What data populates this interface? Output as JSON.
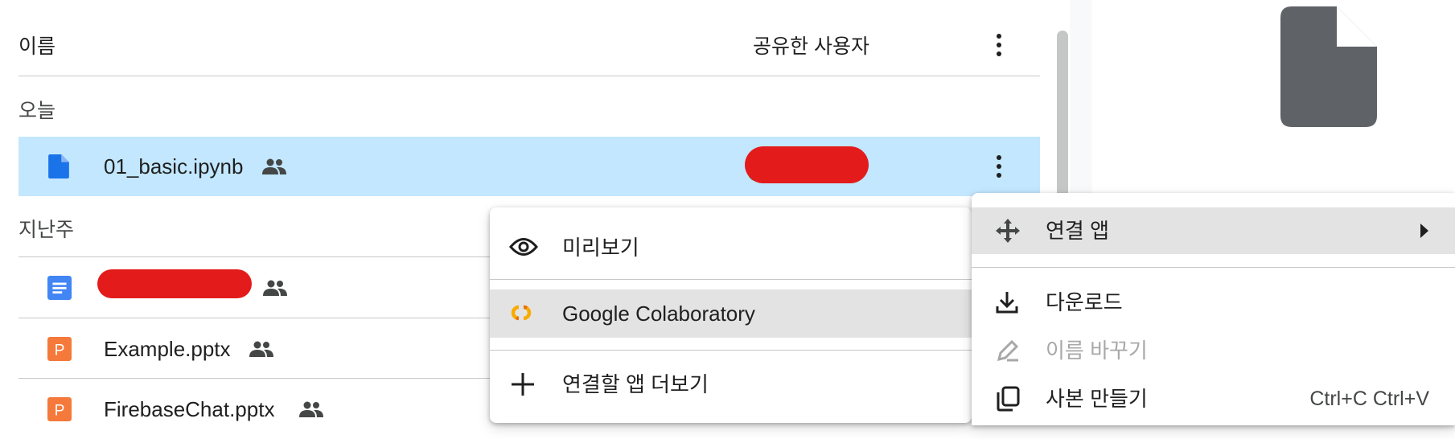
{
  "list_header": {
    "name_col": "이름",
    "shared_col": "공유한 사용자"
  },
  "sections": {
    "today": "오늘",
    "last_week": "지난주"
  },
  "files": [
    {
      "name": "01_basic.ipynb",
      "type": "file-icon",
      "selected": true
    },
    {
      "name": "",
      "type": "docs-icon",
      "redacted": true
    },
    {
      "name": "Example.pptx",
      "type": "slides-icon"
    },
    {
      "name": "FirebaseChat.pptx",
      "type": "slides-icon"
    }
  ],
  "open_with_submenu": {
    "items": [
      {
        "label": "미리보기",
        "icon": "eye-icon"
      },
      {
        "label": "Google Colaboratory",
        "icon": "colab-icon",
        "highlighted": true
      },
      {
        "label": "연결할 앱 더보기",
        "icon": "plus-icon"
      }
    ]
  },
  "context_menu": {
    "items": [
      {
        "label": "연결 앱",
        "icon": "move-icon",
        "highlighted": true,
        "has_submenu": true
      },
      {
        "label": "다운로드",
        "icon": "download-icon"
      },
      {
        "label": "이름 바꾸기",
        "icon": "rename-icon",
        "disabled": true
      },
      {
        "label": "사본 만들기",
        "icon": "copy-icon",
        "shortcut": "Ctrl+C Ctrl+V"
      }
    ]
  },
  "colors": {
    "selected_row": "#c2e7ff",
    "file_blue": "#1a73e8",
    "docs_blue": "#4285f4",
    "slides_orange": "#f5793b",
    "menu_highlight": "#e3e3e3",
    "redaction": "#e31b1b"
  }
}
